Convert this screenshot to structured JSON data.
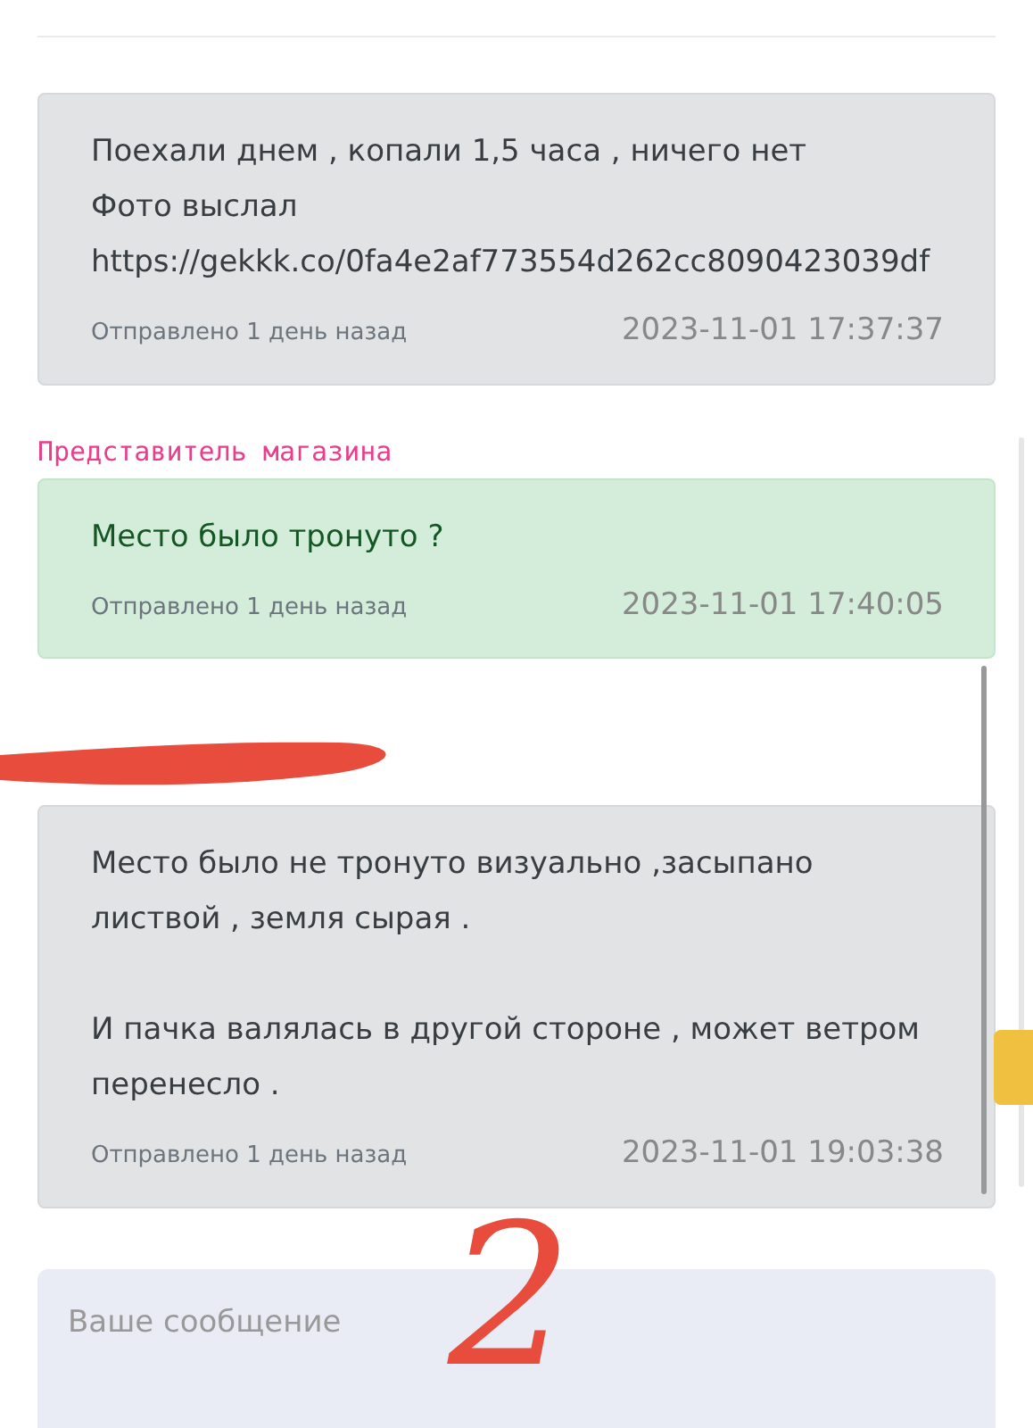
{
  "messages": [
    {
      "kind": "customer",
      "paragraphs": [
        [
          "Поехали днем , копали 1,5 часа , ничего нет",
          "Фото выслал",
          "https://gekkk.co/0fa4e2af773554d262cc8090423039df"
        ]
      ],
      "sent": "Отправлено 1 день назад",
      "timestamp": "2023-11-01 17:37:37"
    },
    {
      "kind": "shop",
      "author": "Представитель магазина",
      "paragraphs": [
        [
          "Место было тронуто ?"
        ]
      ],
      "sent": "Отправлено 1 день назад",
      "timestamp": "2023-11-01 17:40:05"
    },
    {
      "kind": "customer",
      "redacted_author": true,
      "paragraphs": [
        [
          "Место было не тронуто визуально ,засыпано",
          "листвой , земля сырая ."
        ],
        [
          "И пачка валялась в другой стороне , может ветром",
          "перенесло ."
        ]
      ],
      "sent": "Отправлено 1 день назад",
      "timestamp": "2023-11-01 19:03:38"
    }
  ],
  "reply": {
    "placeholder": "Ваше сообщение"
  },
  "annotation": {
    "text": "2"
  }
}
